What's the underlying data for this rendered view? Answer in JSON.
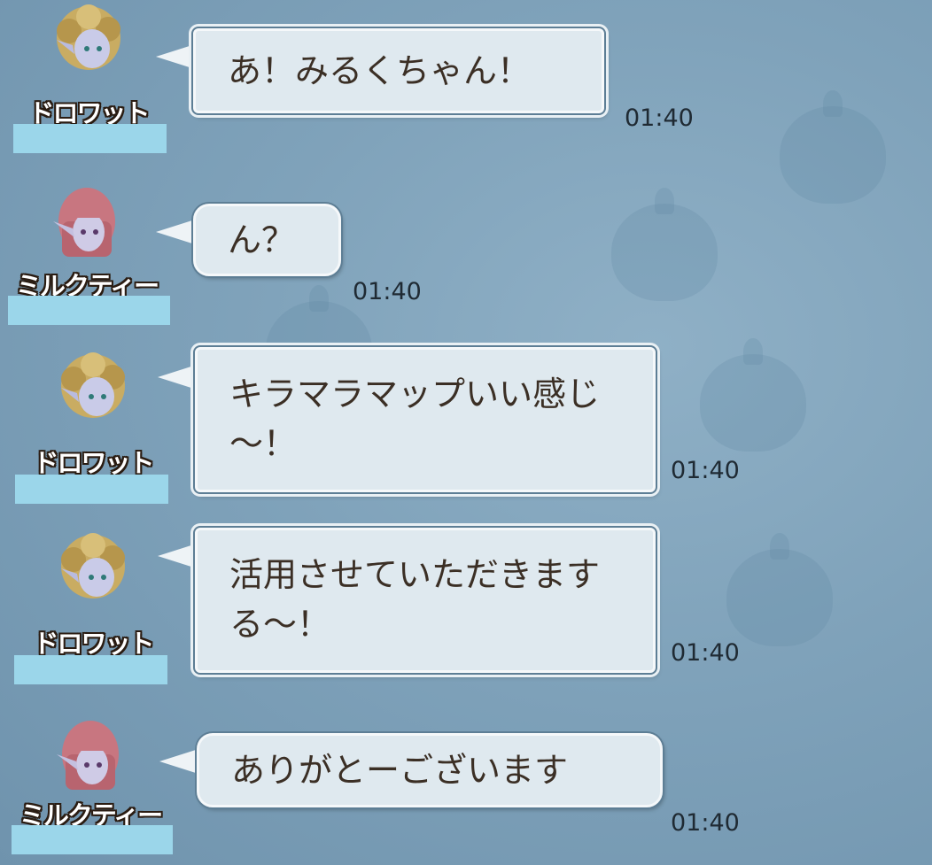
{
  "messages": [
    {
      "sender": "ドロワット",
      "avatar": "drowatt",
      "text": "あ！みるくちゃん！",
      "time": "01:40",
      "style": "spiky"
    },
    {
      "sender": "ミルクティー",
      "avatar": "milktea",
      "text": "ん？",
      "time": "01:40",
      "style": "round"
    },
    {
      "sender": "ドロワット",
      "avatar": "drowatt",
      "text": "キラマラマップいい感じ～！",
      "time": "01:40",
      "style": "spiky"
    },
    {
      "sender": "ドロワット",
      "avatar": "drowatt",
      "text": "活用させていただきまする～！",
      "time": "01:40",
      "style": "spiky"
    },
    {
      "sender": "ミルクティー",
      "avatar": "milktea",
      "text": "ありがとーございます",
      "time": "01:40",
      "style": "round"
    }
  ],
  "colors": {
    "background": "#7fa2ba",
    "bubble": "#dfe9ef",
    "text": "#3b2f25",
    "redaction": "#9bd6ea"
  }
}
